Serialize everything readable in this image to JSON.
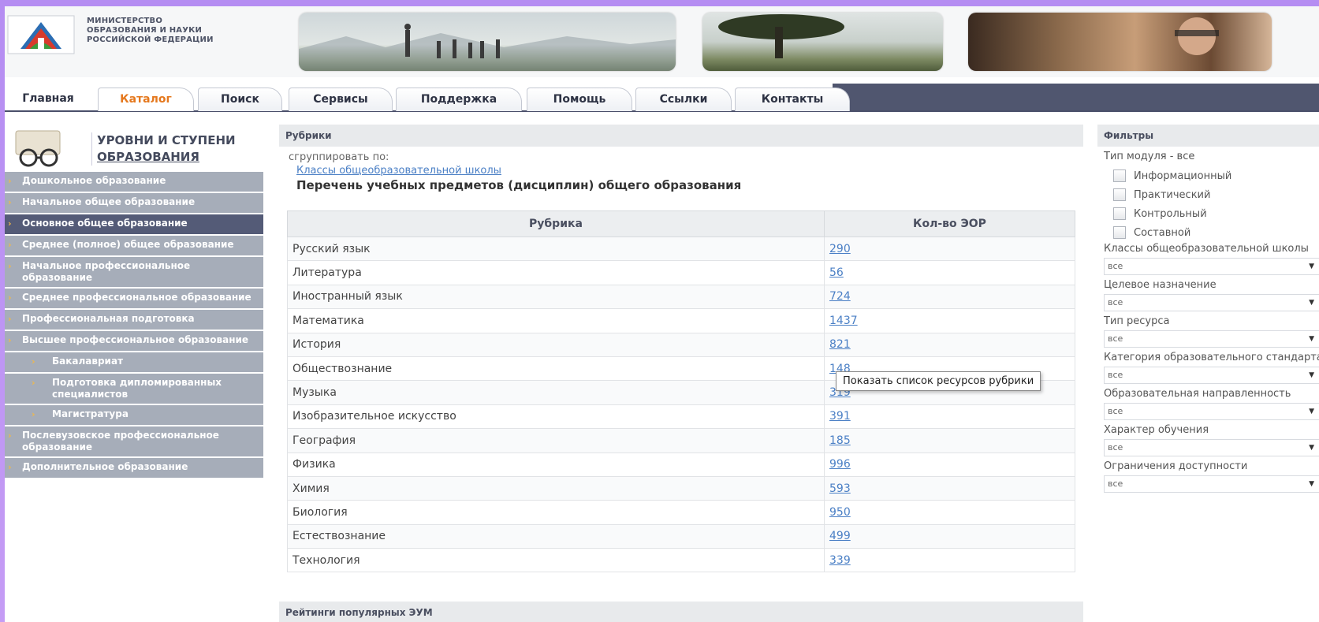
{
  "header": {
    "ministry_lines": [
      "МИНИСТЕРСТВО",
      "ОБРАЗОВАНИЯ И НАУКИ",
      "РОССИЙСКОЙ ФЕДЕРАЦИИ"
    ]
  },
  "tabs": [
    {
      "label": "Главная"
    },
    {
      "label": "Каталог"
    },
    {
      "label": "Поиск"
    },
    {
      "label": "Сервисы"
    },
    {
      "label": "Поддержка"
    },
    {
      "label": "Помощь"
    },
    {
      "label": "Ссылки"
    },
    {
      "label": "Контакты"
    }
  ],
  "sidebar": {
    "title_line1": "УРОВНИ И СТУПЕНИ",
    "title_line2": "ОБРАЗОВАНИЯ",
    "items": [
      {
        "label": "Дошкольное образование"
      },
      {
        "label": "Начальное общее образование"
      },
      {
        "label": "Основное общее образование"
      },
      {
        "label": "Среднее (полное) общее образование"
      },
      {
        "label": "Начальное профессиональное образование"
      },
      {
        "label": "Среднее профессиональное образование"
      },
      {
        "label": "Профессиональная подготовка"
      },
      {
        "label": "Высшее профессиональное образование"
      },
      {
        "label": "Бакалавриат"
      },
      {
        "label": "Подготовка дипломированных специалистов"
      },
      {
        "label": "Магистратура"
      },
      {
        "label": "Послевузовское профессиональное образование"
      },
      {
        "label": "Дополнительное образование"
      }
    ]
  },
  "rubrics": {
    "section_title": "Рубрики",
    "group_by_label": "сгруппировать по:",
    "group_link": "Классы общеобразовательной школы",
    "list_title": "Перечень учебных предметов (дисциплин) общего образования",
    "col_rubric": "Рубрика",
    "col_count": "Кол-во ЭОР",
    "rows": [
      {
        "name": "Русский язык",
        "count": "290"
      },
      {
        "name": "Литература",
        "count": "56"
      },
      {
        "name": "Иностранный язык",
        "count": "724"
      },
      {
        "name": "Математика",
        "count": "1437"
      },
      {
        "name": "История",
        "count": "821"
      },
      {
        "name": "Обществознание",
        "count": "148"
      },
      {
        "name": "Музыка",
        "count": "319"
      },
      {
        "name": "Изобразительное искусство",
        "count": "391"
      },
      {
        "name": "География",
        "count": "185"
      },
      {
        "name": "Физика",
        "count": "996"
      },
      {
        "name": "Химия",
        "count": "593"
      },
      {
        "name": "Биология",
        "count": "950"
      },
      {
        "name": "Естествознание",
        "count": "499"
      },
      {
        "name": "Технология",
        "count": "339"
      }
    ],
    "tooltip": "Показать список ресурсов рубрики"
  },
  "ratings": {
    "title": "Рейтинги популярных ЭУМ"
  },
  "filters": {
    "title": "Фильтры",
    "module_type_label": "Тип модуля - все",
    "checkboxes": [
      "Информационный",
      "Практический",
      "Контрольный",
      "Составной"
    ],
    "selects": [
      {
        "label": "Классы общеобразовательной школы",
        "value": "все"
      },
      {
        "label": "Целевое назначение",
        "value": "все"
      },
      {
        "label": "Тип ресурса",
        "value": "все"
      },
      {
        "label": "Категория образовательного стандарта",
        "value": "все"
      },
      {
        "label": "Образовательная направленность",
        "value": "все"
      },
      {
        "label": "Характер обучения",
        "value": "все"
      },
      {
        "label": "Ограничения доступности",
        "value": "все"
      }
    ]
  },
  "colors": {
    "accent_orange": "#e5781d",
    "link_blue": "#4a7fc5",
    "nav_dark": "#50566f",
    "menu_gray": "#a6adb9",
    "menu_active": "#545b77"
  }
}
